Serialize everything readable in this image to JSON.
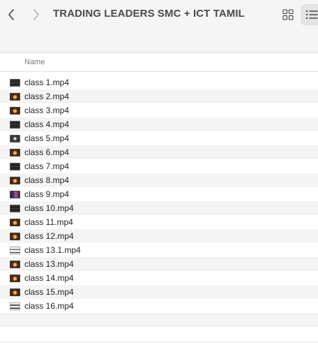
{
  "window": {
    "title": "TRADING LEADERS SMC + ICT TAMIL",
    "back_icon": "chevron-left-icon",
    "forward_icon": "chevron-right-icon",
    "grid_view_icon": "grid-view-icon",
    "list_view_icon": "list-view-icon"
  },
  "columns": {
    "name": "Name"
  },
  "files": [
    {
      "name": "class 1.mp4",
      "thumb": "dark-chart"
    },
    {
      "name": "class 2.mp4",
      "thumb": "orange-face"
    },
    {
      "name": "class 3.mp4",
      "thumb": "orange-face"
    },
    {
      "name": "class 4.mp4",
      "thumb": "dark-chart"
    },
    {
      "name": "class 5.mp4",
      "thumb": "dark-slide"
    },
    {
      "name": "class 6.mp4",
      "thumb": "orange-face"
    },
    {
      "name": "class 7.mp4",
      "thumb": "dark-chart"
    },
    {
      "name": "class 8.mp4",
      "thumb": "orange-face"
    },
    {
      "name": "class 9.mp4",
      "thumb": "purple-chart"
    },
    {
      "name": "class 10.mp4",
      "thumb": "dark-chart"
    },
    {
      "name": "class 11.mp4",
      "thumb": "orange-face"
    },
    {
      "name": "class 12.mp4",
      "thumb": "orange-face"
    },
    {
      "name": "class 13.1.mp4",
      "thumb": "white-slide"
    },
    {
      "name": "class 13.mp4",
      "thumb": "orange-face"
    },
    {
      "name": "class 14.mp4",
      "thumb": "orange-face"
    },
    {
      "name": "class 15.mp4",
      "thumb": "orange-face"
    },
    {
      "name": "class 16.mp4",
      "thumb": "white-slide"
    }
  ],
  "colors": {
    "toolbar_bg": "#f6f5f6",
    "row_alt": "#f4f4f5",
    "title_text": "#4a4a4a",
    "header_text": "#7a7a7a"
  }
}
